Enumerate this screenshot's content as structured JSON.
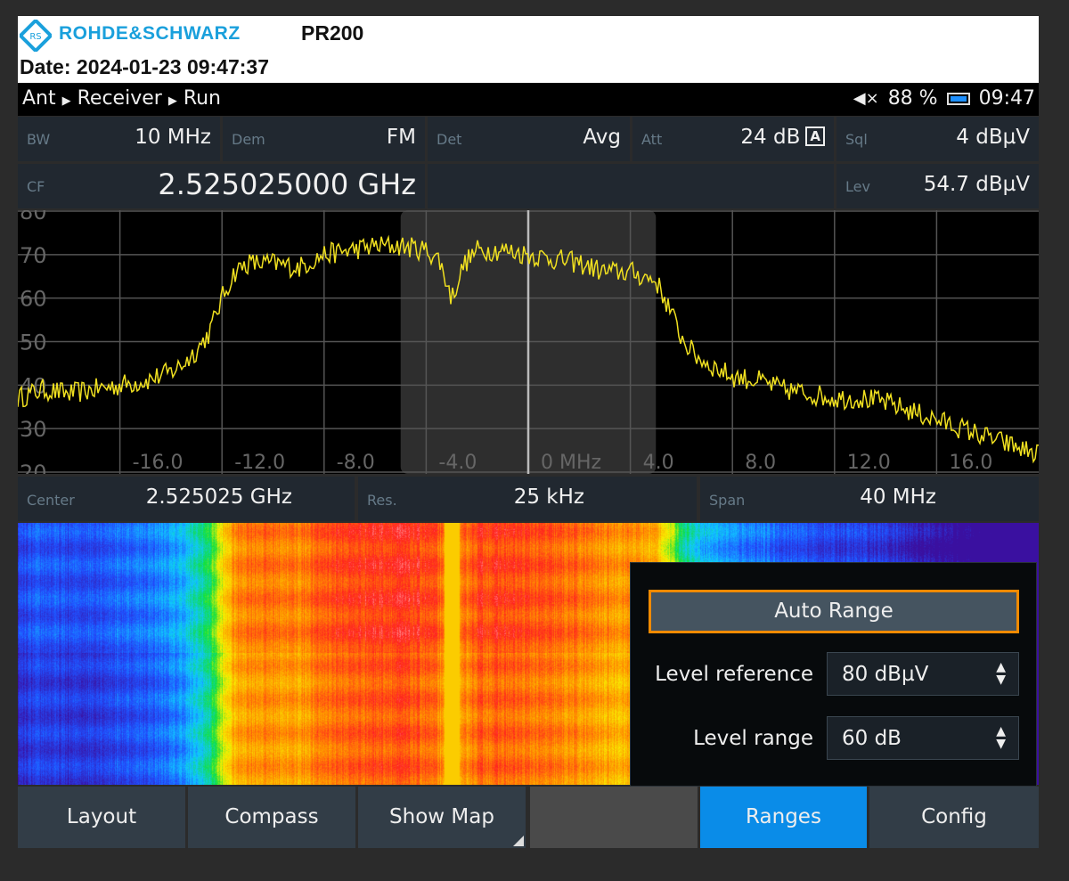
{
  "header": {
    "brand": "ROHDE&SCHWARZ",
    "model": "PR200",
    "date": "Date: 2024-01-23 09:47:37"
  },
  "status": {
    "breadcrumb": [
      "Ant",
      "Receiver",
      "Run"
    ],
    "mute_icon": "speaker-muted-icon",
    "battery": "88 %",
    "battery_icon": "battery-icon",
    "time": "09:47"
  },
  "params": {
    "bw": {
      "label": "BW",
      "value": "10 MHz"
    },
    "dem": {
      "label": "Dem",
      "value": "FM"
    },
    "det": {
      "label": "Det",
      "value": "Avg"
    },
    "att": {
      "label": "Att",
      "value": "24 dB",
      "badge": "A"
    },
    "sql": {
      "label": "Sql",
      "value": "4 dBµV"
    },
    "cf": {
      "label": "CF",
      "value": "2.525025000 GHz"
    },
    "lev": {
      "label": "Lev",
      "value": "54.7 dBµV"
    }
  },
  "info": {
    "center": {
      "label": "Center",
      "value": "2.525025 GHz"
    },
    "res": {
      "label": "Res.",
      "value": "25 kHz"
    },
    "span": {
      "label": "Span",
      "value": "40 MHz"
    }
  },
  "colors": {
    "trace": "#f0e020",
    "accent": "#0a8ce8",
    "focus": "#f08a00",
    "bandwidth_highlight": "#2e2e2e"
  },
  "chart_data": {
    "type": "line",
    "ylim": [
      20,
      80
    ],
    "xlim": [
      -20,
      20
    ],
    "yticks": [
      "80",
      "70",
      "60",
      "50",
      "40",
      "30",
      "20"
    ],
    "xticks": [
      "-16.0",
      "-12.0",
      "-8.0",
      "-4.0",
      "0 MHz",
      "4.0",
      "8.0",
      "12.0",
      "16.0"
    ],
    "grid": true,
    "bandwidth_highlight": [
      -5,
      5
    ],
    "x": [
      -20,
      -19,
      -18,
      -17,
      -16,
      -15,
      -14,
      -13.5,
      -13,
      -12.5,
      -12,
      -11.5,
      -11,
      -10,
      -9,
      -8,
      -7,
      -6,
      -5,
      -4,
      -3.5,
      -3,
      -2.5,
      -2,
      -1,
      0,
      1,
      2,
      3,
      4,
      4.5,
      5,
      5.5,
      6,
      6.5,
      7,
      8,
      9,
      10,
      11,
      12,
      13,
      14,
      15,
      16,
      17,
      18,
      19,
      20
    ],
    "y": [
      37,
      39,
      38,
      39,
      40,
      41,
      43,
      45,
      48,
      52,
      60,
      66,
      68,
      68,
      67,
      70,
      71,
      72,
      72,
      71,
      69,
      60,
      68,
      71,
      71,
      70,
      69,
      68,
      66,
      66,
      65,
      64,
      58,
      51,
      47,
      45,
      42,
      41,
      39,
      38,
      37,
      37,
      36,
      34,
      32,
      30,
      28,
      26,
      24
    ]
  },
  "waterfall": {
    "colormap": [
      "#3a10a0",
      "#2050ff",
      "#10c8ff",
      "#10e040",
      "#f8f000",
      "#ff9000",
      "#ff2020",
      "#ffffff"
    ]
  },
  "ranges_panel": {
    "auto_range": "Auto Range",
    "level_reference": {
      "label": "Level reference",
      "value": "80 dBµV"
    },
    "level_range": {
      "label": "Level range",
      "value": "60 dB"
    }
  },
  "softkeys": [
    "Layout",
    "Compass",
    "Show Map",
    "",
    "Ranges",
    "Config"
  ],
  "active_softkey": "Ranges"
}
